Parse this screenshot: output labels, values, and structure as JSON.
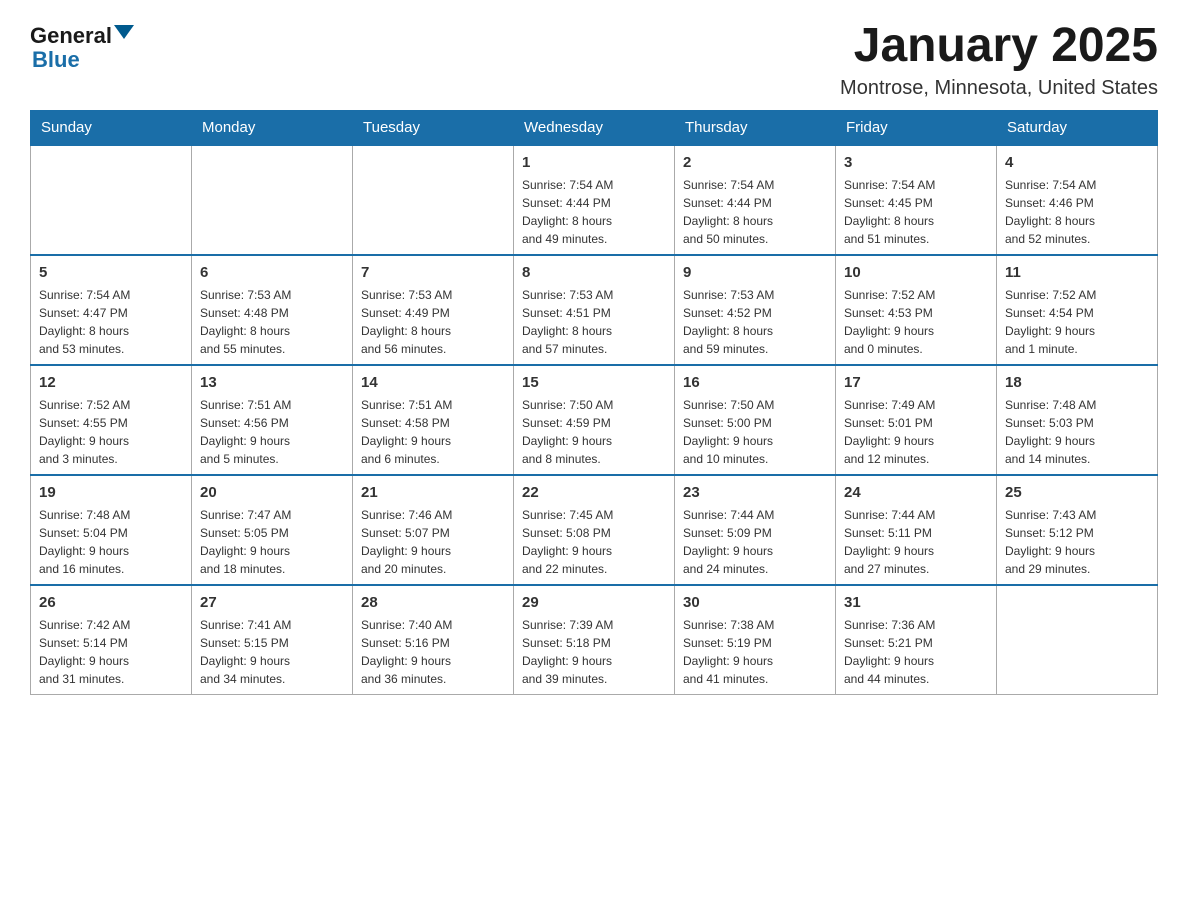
{
  "header": {
    "logo_general": "General",
    "logo_blue": "Blue",
    "month_title": "January 2025",
    "location": "Montrose, Minnesota, United States"
  },
  "days_of_week": [
    "Sunday",
    "Monday",
    "Tuesday",
    "Wednesday",
    "Thursday",
    "Friday",
    "Saturday"
  ],
  "weeks": [
    [
      {
        "day": "",
        "info": ""
      },
      {
        "day": "",
        "info": ""
      },
      {
        "day": "",
        "info": ""
      },
      {
        "day": "1",
        "info": "Sunrise: 7:54 AM\nSunset: 4:44 PM\nDaylight: 8 hours\nand 49 minutes."
      },
      {
        "day": "2",
        "info": "Sunrise: 7:54 AM\nSunset: 4:44 PM\nDaylight: 8 hours\nand 50 minutes."
      },
      {
        "day": "3",
        "info": "Sunrise: 7:54 AM\nSunset: 4:45 PM\nDaylight: 8 hours\nand 51 minutes."
      },
      {
        "day": "4",
        "info": "Sunrise: 7:54 AM\nSunset: 4:46 PM\nDaylight: 8 hours\nand 52 minutes."
      }
    ],
    [
      {
        "day": "5",
        "info": "Sunrise: 7:54 AM\nSunset: 4:47 PM\nDaylight: 8 hours\nand 53 minutes."
      },
      {
        "day": "6",
        "info": "Sunrise: 7:53 AM\nSunset: 4:48 PM\nDaylight: 8 hours\nand 55 minutes."
      },
      {
        "day": "7",
        "info": "Sunrise: 7:53 AM\nSunset: 4:49 PM\nDaylight: 8 hours\nand 56 minutes."
      },
      {
        "day": "8",
        "info": "Sunrise: 7:53 AM\nSunset: 4:51 PM\nDaylight: 8 hours\nand 57 minutes."
      },
      {
        "day": "9",
        "info": "Sunrise: 7:53 AM\nSunset: 4:52 PM\nDaylight: 8 hours\nand 59 minutes."
      },
      {
        "day": "10",
        "info": "Sunrise: 7:52 AM\nSunset: 4:53 PM\nDaylight: 9 hours\nand 0 minutes."
      },
      {
        "day": "11",
        "info": "Sunrise: 7:52 AM\nSunset: 4:54 PM\nDaylight: 9 hours\nand 1 minute."
      }
    ],
    [
      {
        "day": "12",
        "info": "Sunrise: 7:52 AM\nSunset: 4:55 PM\nDaylight: 9 hours\nand 3 minutes."
      },
      {
        "day": "13",
        "info": "Sunrise: 7:51 AM\nSunset: 4:56 PM\nDaylight: 9 hours\nand 5 minutes."
      },
      {
        "day": "14",
        "info": "Sunrise: 7:51 AM\nSunset: 4:58 PM\nDaylight: 9 hours\nand 6 minutes."
      },
      {
        "day": "15",
        "info": "Sunrise: 7:50 AM\nSunset: 4:59 PM\nDaylight: 9 hours\nand 8 minutes."
      },
      {
        "day": "16",
        "info": "Sunrise: 7:50 AM\nSunset: 5:00 PM\nDaylight: 9 hours\nand 10 minutes."
      },
      {
        "day": "17",
        "info": "Sunrise: 7:49 AM\nSunset: 5:01 PM\nDaylight: 9 hours\nand 12 minutes."
      },
      {
        "day": "18",
        "info": "Sunrise: 7:48 AM\nSunset: 5:03 PM\nDaylight: 9 hours\nand 14 minutes."
      }
    ],
    [
      {
        "day": "19",
        "info": "Sunrise: 7:48 AM\nSunset: 5:04 PM\nDaylight: 9 hours\nand 16 minutes."
      },
      {
        "day": "20",
        "info": "Sunrise: 7:47 AM\nSunset: 5:05 PM\nDaylight: 9 hours\nand 18 minutes."
      },
      {
        "day": "21",
        "info": "Sunrise: 7:46 AM\nSunset: 5:07 PM\nDaylight: 9 hours\nand 20 minutes."
      },
      {
        "day": "22",
        "info": "Sunrise: 7:45 AM\nSunset: 5:08 PM\nDaylight: 9 hours\nand 22 minutes."
      },
      {
        "day": "23",
        "info": "Sunrise: 7:44 AM\nSunset: 5:09 PM\nDaylight: 9 hours\nand 24 minutes."
      },
      {
        "day": "24",
        "info": "Sunrise: 7:44 AM\nSunset: 5:11 PM\nDaylight: 9 hours\nand 27 minutes."
      },
      {
        "day": "25",
        "info": "Sunrise: 7:43 AM\nSunset: 5:12 PM\nDaylight: 9 hours\nand 29 minutes."
      }
    ],
    [
      {
        "day": "26",
        "info": "Sunrise: 7:42 AM\nSunset: 5:14 PM\nDaylight: 9 hours\nand 31 minutes."
      },
      {
        "day": "27",
        "info": "Sunrise: 7:41 AM\nSunset: 5:15 PM\nDaylight: 9 hours\nand 34 minutes."
      },
      {
        "day": "28",
        "info": "Sunrise: 7:40 AM\nSunset: 5:16 PM\nDaylight: 9 hours\nand 36 minutes."
      },
      {
        "day": "29",
        "info": "Sunrise: 7:39 AM\nSunset: 5:18 PM\nDaylight: 9 hours\nand 39 minutes."
      },
      {
        "day": "30",
        "info": "Sunrise: 7:38 AM\nSunset: 5:19 PM\nDaylight: 9 hours\nand 41 minutes."
      },
      {
        "day": "31",
        "info": "Sunrise: 7:36 AM\nSunset: 5:21 PM\nDaylight: 9 hours\nand 44 minutes."
      },
      {
        "day": "",
        "info": ""
      }
    ]
  ]
}
